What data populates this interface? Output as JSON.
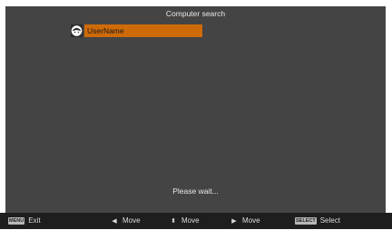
{
  "screen": {
    "title": "Computer search",
    "status_text": "Please wait..."
  },
  "list": {
    "items": [
      {
        "label": "UserName",
        "selected": true,
        "icon": "user-avatar-icon"
      }
    ]
  },
  "footer": {
    "menu_key": "MENU",
    "exit_label": "Exit",
    "left_glyph": "◀",
    "left_label": "Move",
    "updown_glyph": "⬍",
    "updown_label": "Move",
    "right_glyph": "▶",
    "right_label": "Move",
    "select_key": "SELECT",
    "select_label": "Select"
  },
  "colors": {
    "screen_bg": "#444444",
    "selection": "#cf6a08",
    "footer_bg": "#1e1e1e"
  }
}
